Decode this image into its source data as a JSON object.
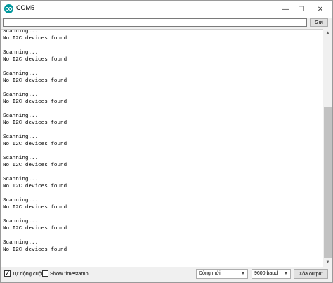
{
  "window": {
    "title": "COM5",
    "controls": {
      "minimize": "—",
      "maximize": "☐",
      "close": "✕"
    }
  },
  "send": {
    "value": "",
    "button_label": "Gửi"
  },
  "output_lines": [
    "Scanning...",
    "No I2C devices found",
    "",
    "Scanning...",
    "No I2C devices found",
    "",
    "Scanning...",
    "No I2C devices found",
    "",
    "Scanning...",
    "No I2C devices found",
    "",
    "Scanning...",
    "No I2C devices found",
    "",
    "Scanning...",
    "No I2C devices found",
    "",
    "Scanning...",
    "No I2C devices found",
    "",
    "Scanning...",
    "No I2C devices found",
    "",
    "Scanning...",
    "No I2C devices found",
    "",
    "Scanning...",
    "No I2C devices found",
    "",
    "Scanning...",
    "No I2C devices found"
  ],
  "footer": {
    "autoscroll": {
      "label": "Tự động cuộn",
      "checked": true
    },
    "timestamp": {
      "label": "Show timestamp",
      "checked": false
    },
    "line_ending": "Dòng mới",
    "baud": "9600 baud",
    "clear_label": "Xóa output"
  }
}
